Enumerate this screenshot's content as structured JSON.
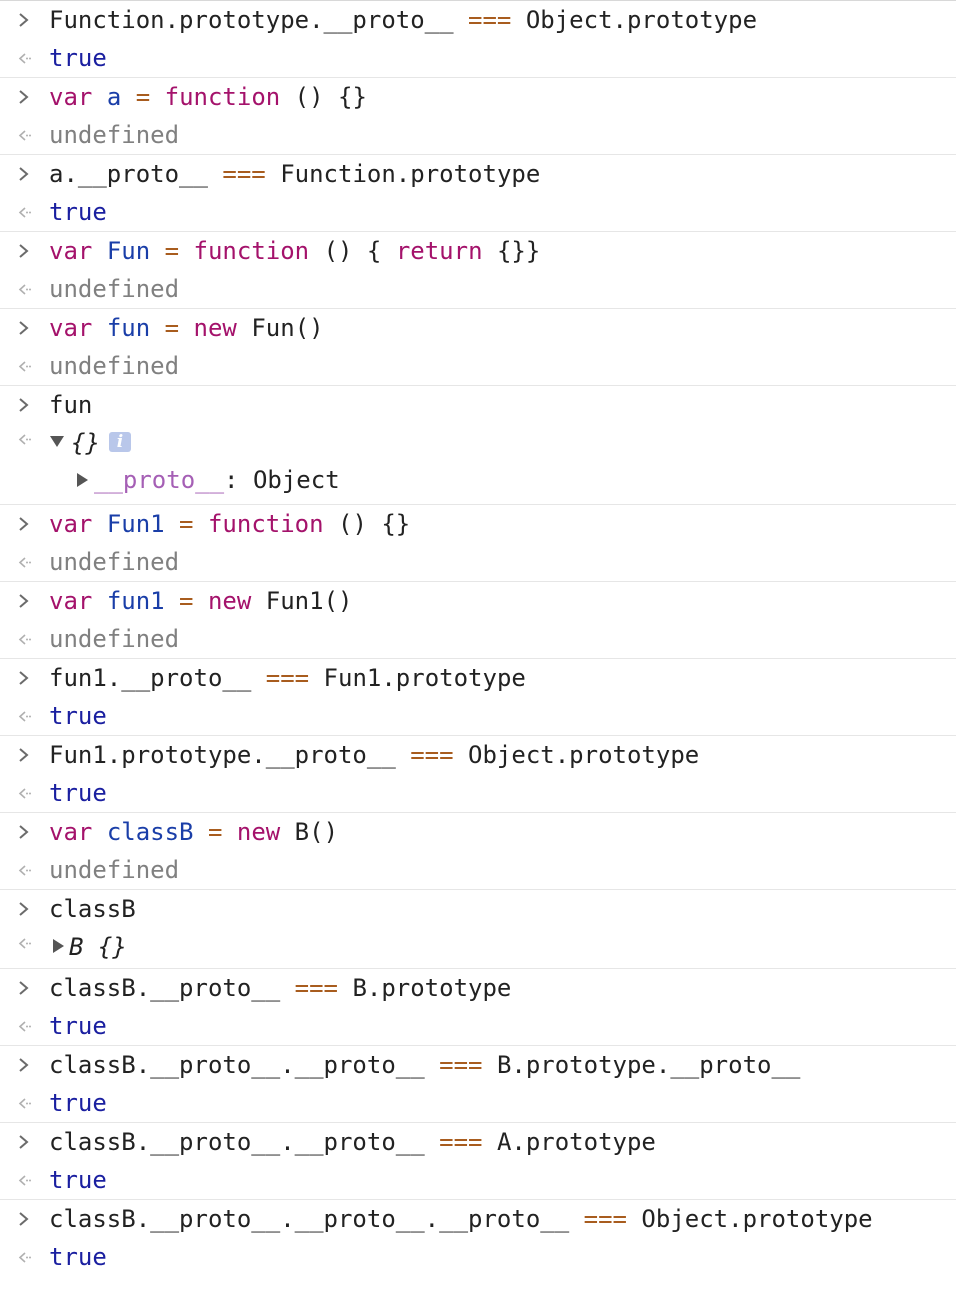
{
  "console": {
    "entries": [
      {
        "input": [
          [
            "Function.prototype.__proto__",
            "plain"
          ],
          [
            " === ",
            "op"
          ],
          [
            "Object.prototype",
            "plain"
          ]
        ],
        "output": "true",
        "output_type": "true"
      },
      {
        "input": [
          [
            "var",
            "kw"
          ],
          [
            " ",
            "plain"
          ],
          [
            "a",
            "var"
          ],
          [
            " = ",
            "op"
          ],
          [
            "function",
            "kw"
          ],
          [
            " () {}",
            "plain"
          ]
        ],
        "output": "undefined",
        "output_type": "undef"
      },
      {
        "input": [
          [
            "a.__proto__",
            "plain"
          ],
          [
            " === ",
            "op"
          ],
          [
            "Function.prototype",
            "plain"
          ]
        ],
        "output": "true",
        "output_type": "true"
      },
      {
        "input": [
          [
            "var",
            "kw"
          ],
          [
            " ",
            "plain"
          ],
          [
            "Fun",
            "var"
          ],
          [
            " = ",
            "op"
          ],
          [
            "function",
            "kw"
          ],
          [
            " () { ",
            "plain"
          ],
          [
            "return",
            "kw"
          ],
          [
            " {}}",
            "plain"
          ]
        ],
        "output": "undefined",
        "output_type": "undef"
      },
      {
        "input": [
          [
            "var",
            "kw"
          ],
          [
            " ",
            "plain"
          ],
          [
            "fun",
            "var"
          ],
          [
            " = ",
            "op"
          ],
          [
            "new",
            "kw"
          ],
          [
            " Fun()",
            "plain"
          ]
        ],
        "output": "undefined",
        "output_type": "undef"
      },
      {
        "input": [
          [
            "fun",
            "plain"
          ]
        ],
        "output_object": {
          "preview": "{}",
          "info_icon": "info-icon",
          "children": [
            {
              "key": "__proto__",
              "value": "Object"
            }
          ]
        }
      },
      {
        "input": [
          [
            "var",
            "kw"
          ],
          [
            " ",
            "plain"
          ],
          [
            "Fun1",
            "var"
          ],
          [
            " = ",
            "op"
          ],
          [
            "function",
            "kw"
          ],
          [
            " () {}",
            "plain"
          ]
        ],
        "output": "undefined",
        "output_type": "undef"
      },
      {
        "input": [
          [
            "var",
            "kw"
          ],
          [
            " ",
            "plain"
          ],
          [
            "fun1",
            "var"
          ],
          [
            " = ",
            "op"
          ],
          [
            "new",
            "kw"
          ],
          [
            " Fun1()",
            "plain"
          ]
        ],
        "output": "undefined",
        "output_type": "undef"
      },
      {
        "input": [
          [
            "fun1.__proto__",
            "plain"
          ],
          [
            " === ",
            "op"
          ],
          [
            "Fun1.prototype",
            "plain"
          ]
        ],
        "output": "true",
        "output_type": "true"
      },
      {
        "input": [
          [
            "Fun1.prototype.__proto__",
            "plain"
          ],
          [
            " === ",
            "op"
          ],
          [
            "Object.prototype",
            "plain"
          ]
        ],
        "output": "true",
        "output_type": "true"
      },
      {
        "input": [
          [
            "var",
            "kw"
          ],
          [
            " ",
            "plain"
          ],
          [
            "classB",
            "var"
          ],
          [
            " = ",
            "op"
          ],
          [
            "new",
            "kw"
          ],
          [
            " B()",
            "plain"
          ]
        ],
        "output": "undefined",
        "output_type": "undef"
      },
      {
        "input": [
          [
            "classB",
            "plain"
          ]
        ],
        "output_collapsed": {
          "class_name": "B",
          "preview": "{}"
        }
      },
      {
        "input": [
          [
            "classB.__proto__",
            "plain"
          ],
          [
            " === ",
            "op"
          ],
          [
            "B.prototype",
            "plain"
          ]
        ],
        "output": "true",
        "output_type": "true"
      },
      {
        "input": [
          [
            "classB.__proto__.__proto__",
            "plain"
          ],
          [
            " === ",
            "op"
          ],
          [
            "B.prototype.__proto__",
            "plain"
          ]
        ],
        "output": "true",
        "output_type": "true"
      },
      {
        "input": [
          [
            "classB.__proto__.__proto__",
            "plain"
          ],
          [
            " === ",
            "op"
          ],
          [
            "A.prototype",
            "plain"
          ]
        ],
        "output": "true",
        "output_type": "true"
      },
      {
        "input": [
          [
            "classB.__proto__.__proto__.__proto__",
            "plain"
          ],
          [
            " === ",
            "op"
          ],
          [
            "Object.prototype",
            "plain"
          ]
        ],
        "output": "true",
        "output_type": "true"
      }
    ]
  },
  "icons": {
    "input_prompt": "chevron-right-icon",
    "result_prompt": "result-arrow-icon"
  },
  "colors": {
    "keyword": "#a4126b",
    "variable": "#1a3ea8",
    "operator": "#a85c1e",
    "boolean": "#1a1fa0",
    "undefined": "#808080"
  }
}
